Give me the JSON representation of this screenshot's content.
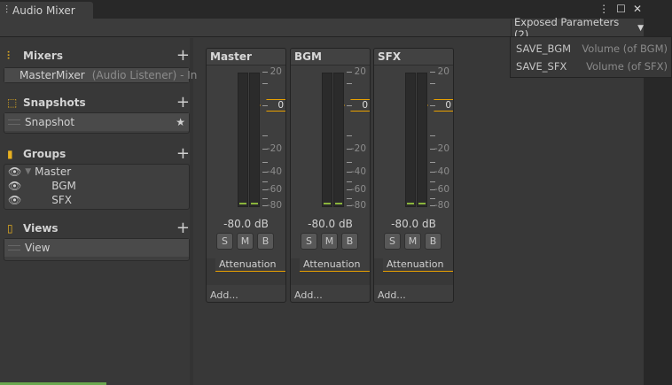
{
  "window": {
    "tab_title": "Audio Mixer",
    "icon": "mixer-sliders-icon",
    "menu_icon": "kebab-menu-icon",
    "maximize_icon": "maximize-icon",
    "close_icon": "close-icon"
  },
  "toolbar": {
    "exposed_label": "Exposed Parameters (2)",
    "exposed_params": [
      {
        "name": "SAVE_BGM",
        "target": "Volume (of BGM)"
      },
      {
        "name": "SAVE_SFX",
        "target": "Volume (of SFX)"
      }
    ]
  },
  "sidebar": {
    "mixers": {
      "title": "Mixers",
      "items": [
        {
          "name": "MasterMixer",
          "detail": "(Audio Listener) - In"
        }
      ]
    },
    "snapshots": {
      "title": "Snapshots",
      "items": [
        {
          "name": "Snapshot"
        }
      ]
    },
    "groups": {
      "title": "Groups",
      "items": [
        {
          "name": "Master"
        },
        {
          "name": "BGM"
        },
        {
          "name": "SFX"
        }
      ]
    },
    "views": {
      "title": "Views",
      "items": [
        {
          "name": "View"
        }
      ]
    }
  },
  "scale": [
    "20",
    "0",
    "-20",
    "-40",
    "-60",
    "-80"
  ],
  "strips": [
    {
      "name": "Master",
      "fader": "0",
      "volume": "-80.0 dB",
      "buttons": [
        "S",
        "M",
        "B"
      ],
      "effect": "Attenuation",
      "add": "Add..."
    },
    {
      "name": "BGM",
      "fader": "0",
      "volume": "-80.0 dB",
      "buttons": [
        "S",
        "M",
        "B"
      ],
      "effect": "Attenuation",
      "add": "Add..."
    },
    {
      "name": "SFX",
      "fader": "0",
      "volume": "-80.0 dB",
      "buttons": [
        "S",
        "M",
        "B"
      ],
      "effect": "Attenuation",
      "add": "Add..."
    }
  ],
  "colors": {
    "accent": "#e8a000",
    "meter": "#8ab43c"
  }
}
